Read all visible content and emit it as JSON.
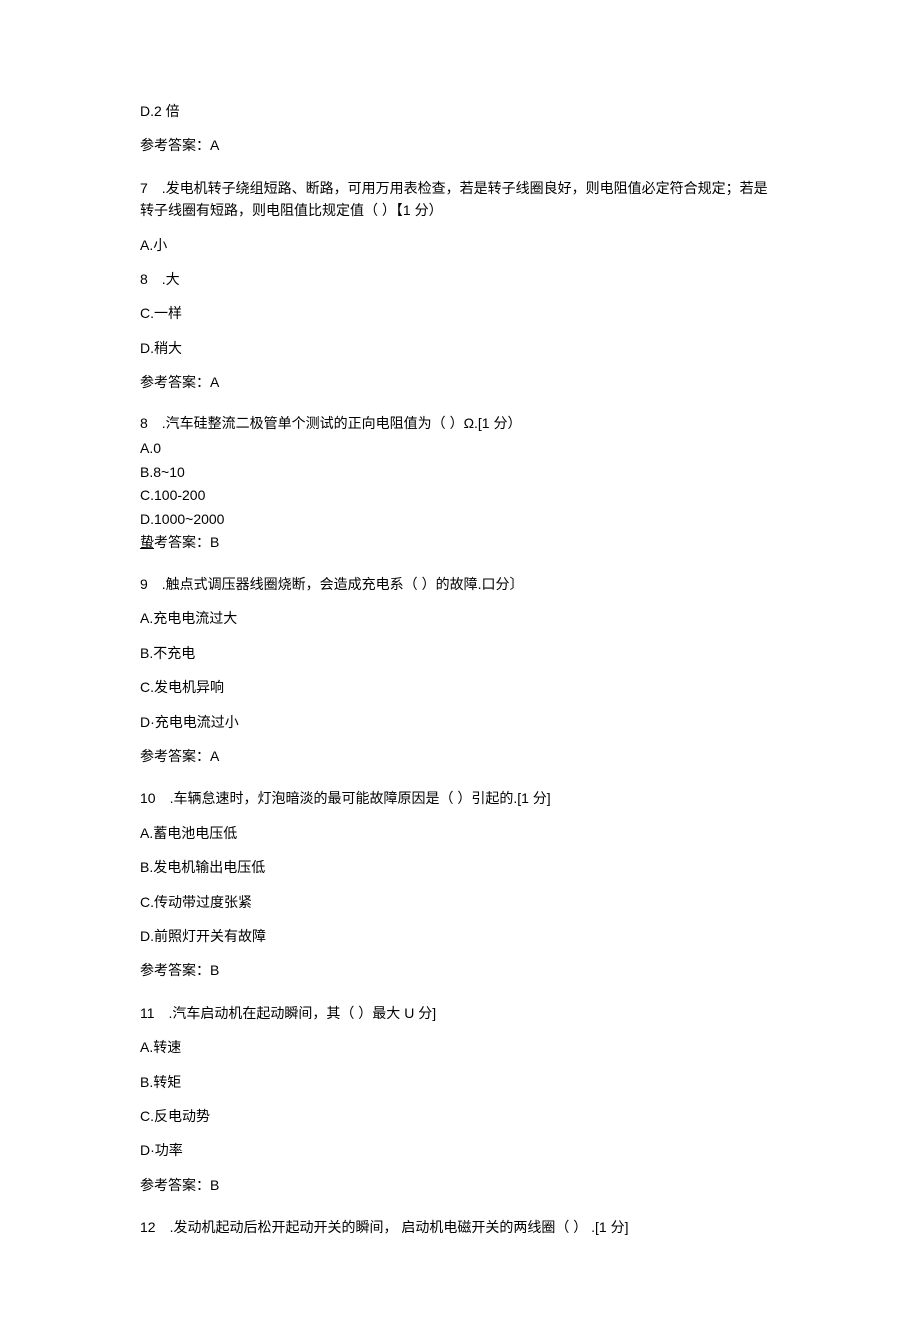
{
  "q6": {
    "optionD": "D.2 倍",
    "answer": "参考答案：A"
  },
  "q7": {
    "stem": "7 .发电机转子绕组短路、断路，可用万用表检查，若是转子线圈良好，则电阻值必定符合规定；若是转子线圈有短路，则电阻值比规定值（ ）【1 分）",
    "optionA": "A.小",
    "optionB": "8 .大",
    "optionC": "C.一样",
    "optionD": "D.稍大",
    "answer": "参考答案：A"
  },
  "q8": {
    "stem": "8 .汽车硅整流二极管单个测试的正向电阻值为（ ）Ω.[1 分）",
    "optionA": "A.0",
    "optionB": "B.8~10",
    "optionC": "C.100-200",
    "optionD": "D.1000~2000",
    "answer_prefix": "蛰",
    "answer_suffix": "考答案：B"
  },
  "q9": {
    "stem": "9 .触点式调压器线圈烧断，会造成充电系（ ）的故障.口分〕",
    "optionA": "A.充电电流过大",
    "optionB": "B.不充电",
    "optionC": "C.发电机异响",
    "optionD": "D·充电电流过小",
    "answer": "参考答案：A"
  },
  "q10": {
    "stem": "10 .车辆怠速时，灯泡暗淡的最可能故障原因是（ ）引起的.[1 分]",
    "optionA": "A.蓄电池电压低",
    "optionB": "B.发电机输出电压低",
    "optionC": "C.传动带过度张紧",
    "optionD": "D.前照灯开关有故障",
    "answer": "参考答案：B"
  },
  "q11": {
    "stem": "11 .汽车启动机在起动瞬间，其（ ）最大 U 分]",
    "optionA": "A.转速",
    "optionB": "B.转矩",
    "optionC": "C.反电动势",
    "optionD": "D·功率",
    "answer": "参考答案：B"
  },
  "q12": {
    "stem": "12 .发动机起动后松开起动开关的瞬间， 启动机电磁开关的两线圈（ ） .[1 分]"
  }
}
